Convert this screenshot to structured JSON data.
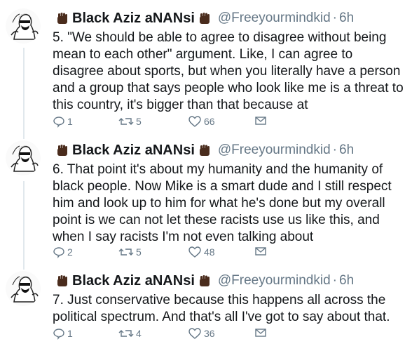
{
  "tweets": [
    {
      "name": "Black Aziz aNANsi",
      "handle": "@Freeyourmindkid",
      "separator": "·",
      "time": "6h",
      "lines": [
        "5. \"We should be able to agree to disagree without being",
        "mean to each other\" argument. Like, I can agree to",
        "disagree about sports, but when you literally have a person",
        "and a group that says people who look like me is a threat to",
        "this country, it's bigger than that because at"
      ],
      "replies": "1",
      "retweets": "5",
      "likes": "66"
    },
    {
      "name": "Black Aziz aNANsi",
      "handle": "@Freeyourmindkid",
      "separator": "·",
      "time": "6h",
      "lines": [
        "6. That point it's about my humanity and the humanity of",
        "black people. Now Mike is a smart dude and I still respect",
        "him and look up to him for what he's done but my overall",
        "point is we can not let these racists use us like this, and",
        "when I say racists I'm not even talking about"
      ],
      "replies": "2",
      "retweets": "5",
      "likes": "48"
    },
    {
      "name": "Black Aziz aNANsi",
      "handle": "@Freeyourmindkid",
      "separator": "·",
      "time": "6h",
      "lines": [
        "7. Just conservative because this happens all across the",
        "political spectrum. And that's all I've got to say about that."
      ],
      "replies": "1",
      "retweets": "4",
      "likes": "36"
    }
  ],
  "icons": {
    "reply": "reply-icon",
    "retweet": "retweet-icon",
    "like": "heart-icon",
    "message": "envelope-icon",
    "emoji": "raised-fist-emoji"
  },
  "colors": {
    "text": "#14171a",
    "secondary": "#657786",
    "thread_line": "#e1e8ed",
    "fist": "#4a2c1d"
  }
}
